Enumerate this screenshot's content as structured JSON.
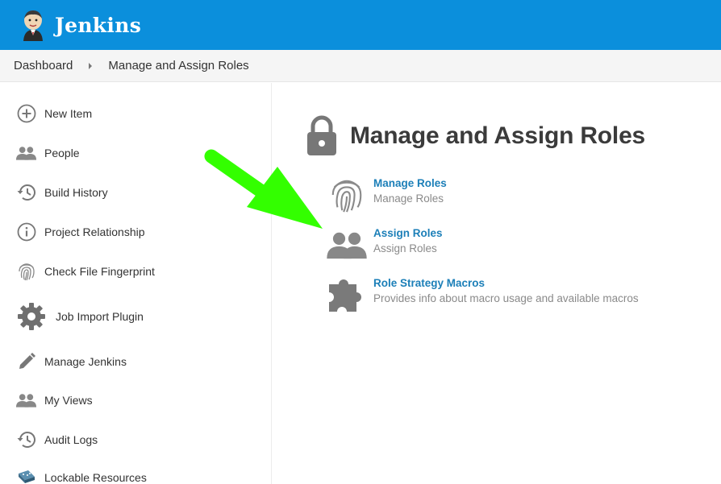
{
  "header": {
    "brand": "Jenkins"
  },
  "breadcrumb": {
    "items": [
      {
        "label": "Dashboard"
      },
      {
        "label": "Manage and Assign Roles"
      }
    ]
  },
  "sidebar": {
    "items": [
      {
        "label": "New Item",
        "icon": "plus-circle-icon"
      },
      {
        "label": "People",
        "icon": "people-icon"
      },
      {
        "label": "Build History",
        "icon": "history-icon"
      },
      {
        "label": "Project Relationship",
        "icon": "info-icon"
      },
      {
        "label": "Check File Fingerprint",
        "icon": "fingerprint-icon"
      },
      {
        "label": "Job Import Plugin",
        "icon": "gear-icon"
      },
      {
        "label": "Manage Jenkins",
        "icon": "pencil-icon"
      },
      {
        "label": "My Views",
        "icon": "people-icon"
      },
      {
        "label": "Audit Logs",
        "icon": "history-icon"
      },
      {
        "label": "Lockable Resources",
        "icon": "network-icon"
      }
    ]
  },
  "main": {
    "title": "Manage and Assign Roles",
    "entries": [
      {
        "link": "Manage Roles",
        "desc": "Manage Roles",
        "icon": "fingerprint-icon"
      },
      {
        "link": "Assign Roles",
        "desc": "Assign Roles",
        "icon": "people-icon"
      },
      {
        "link": "Role Strategy Macros",
        "desc": "Provides info about macro usage and available macros",
        "icon": "puzzle-icon"
      }
    ]
  },
  "colors": {
    "header_bg": "#0b8fdc",
    "link": "#1c7fb8",
    "annotation_arrow": "#33ff00"
  }
}
